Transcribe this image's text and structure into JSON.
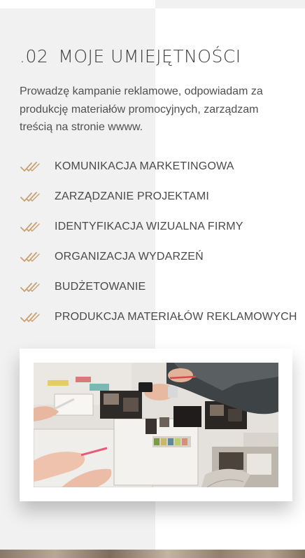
{
  "section": {
    "number": ".02",
    "title": "MOJE UMIEJĘTNOŚCI",
    "intro": "Prowadzę kampanie reklamowe, odpowiadam za produkcję materiałów promocyjnych, zarządzam treścią na stronie wwww."
  },
  "skills": [
    {
      "label": "KOMUNIKACJA MARKETINGOWA",
      "icon": "double-check-icon"
    },
    {
      "label": "ZARZĄDZANIE PROJEKTAMI",
      "icon": "double-check-icon"
    },
    {
      "label": "IDENTYFIKACJA WIZUALNA FIRMY",
      "icon": "double-check-icon"
    },
    {
      "label": "ORGANIZACJA WYDARZEŃ",
      "icon": "double-check-icon"
    },
    {
      "label": "BUDŻETOWANIE",
      "icon": "double-check-icon"
    },
    {
      "label": "PRODUKCJA MATERIAŁÓW REKLAMOWYCH",
      "icon": "double-check-icon"
    }
  ],
  "photo": {
    "description_icon": "team-working-photo"
  },
  "colors": {
    "accent": "#c9a072",
    "panel": "#f1f1f1",
    "text": "#4a4a4a"
  }
}
